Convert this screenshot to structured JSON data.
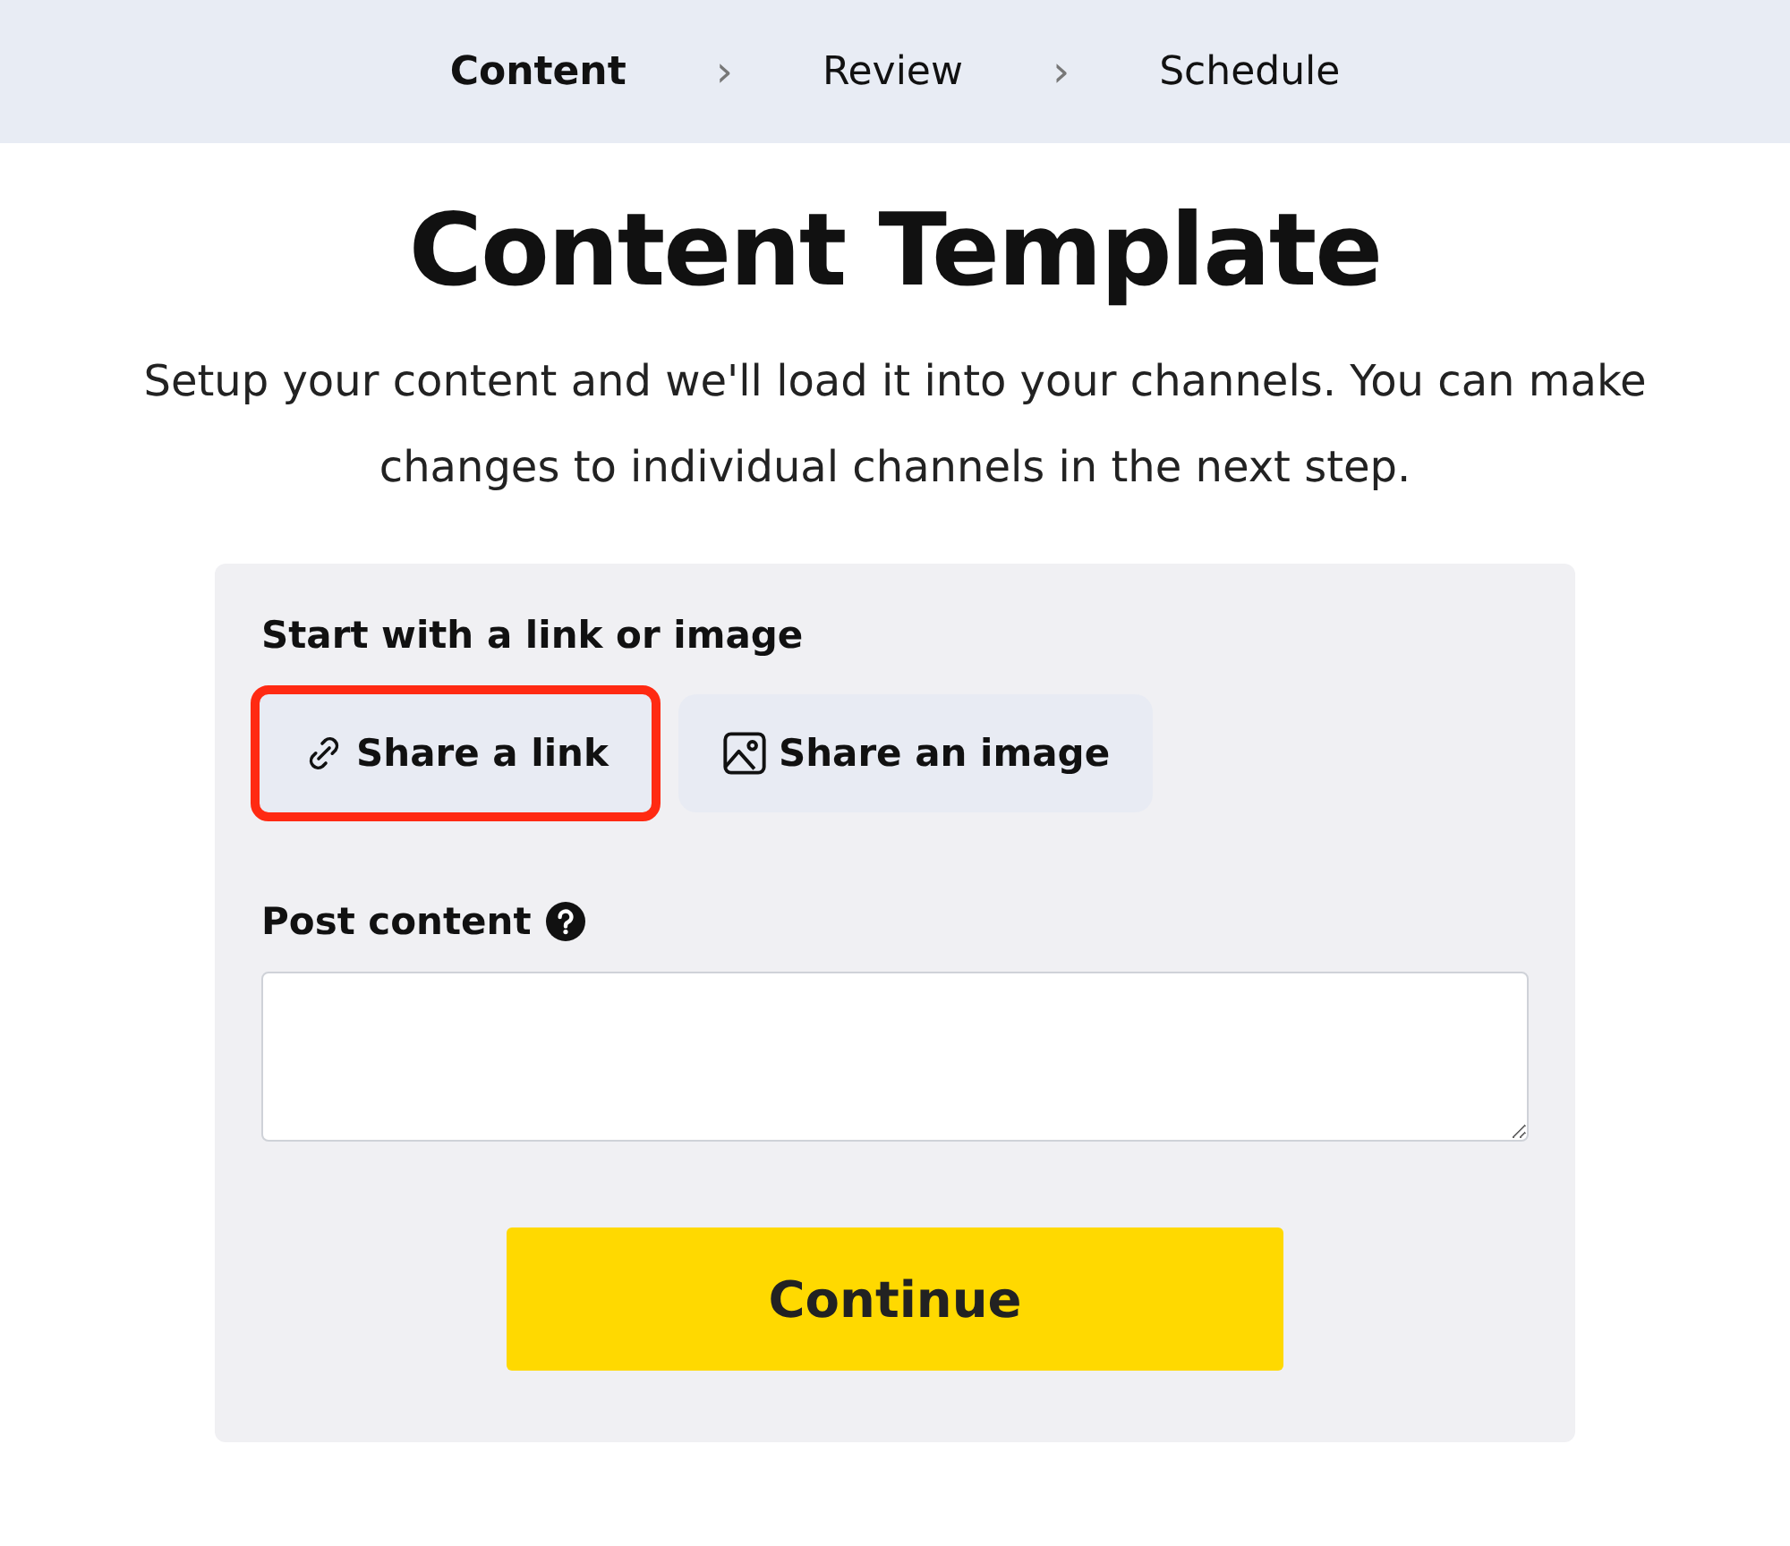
{
  "steps": [
    {
      "label": "Content",
      "selected": true
    },
    {
      "label": "Review",
      "selected": false
    },
    {
      "label": "Schedule",
      "selected": false
    }
  ],
  "step_separator": "›",
  "title": "Content Template",
  "subtitle": "Setup your content and we'll load it into your channels. You can make changes to individual channels in the next step.",
  "form": {
    "source_label": "Start with a link or image",
    "source_options": [
      {
        "kind": "link",
        "label": "Share a link",
        "highlighted": true
      },
      {
        "kind": "image",
        "label": "Share an image",
        "highlighted": false
      }
    ],
    "post_content_label": "Post content",
    "continue_button": "Continue"
  }
}
